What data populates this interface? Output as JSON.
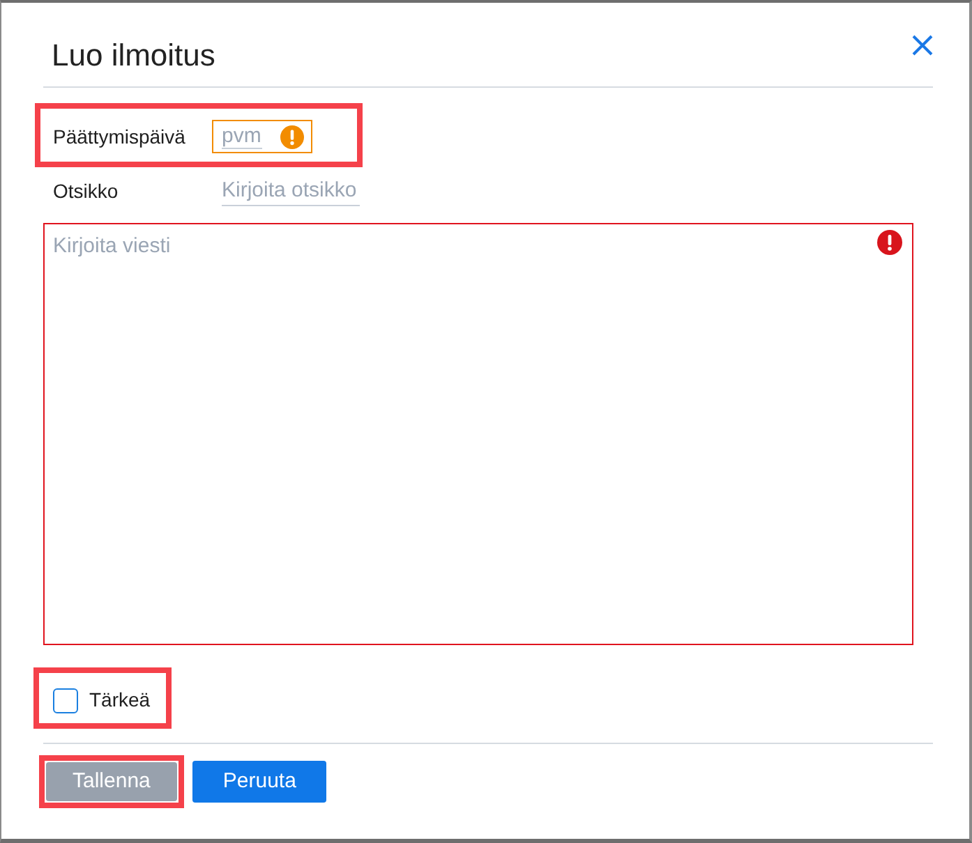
{
  "dialog": {
    "title": "Luo ilmoitus"
  },
  "fields": [
    {
      "kind": "date",
      "label": "Päättymispäivä",
      "placeholder": "pvm",
      "warning": true,
      "highlighted": true
    },
    {
      "kind": "text",
      "label": "Otsikko",
      "placeholder": "Kirjoita otsikko",
      "warning": false,
      "highlighted": false
    }
  ],
  "message": {
    "placeholder": "Kirjoita viesti",
    "error": true
  },
  "important": {
    "label": "Tärkeä",
    "checked": false,
    "highlighted": true
  },
  "buttons": [
    {
      "label": "Tallenna",
      "disabled": true,
      "highlighted": true
    },
    {
      "label": "Peruuta",
      "disabled": false,
      "highlighted": false
    }
  ]
}
